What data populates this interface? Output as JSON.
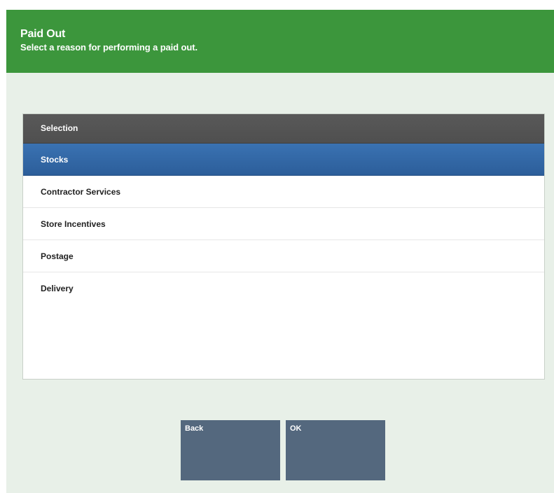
{
  "header": {
    "title": "Paid Out",
    "subtitle": "Select a reason for performing a paid out."
  },
  "list": {
    "column_header": "Selection",
    "selected_index": 0,
    "items": [
      "Stocks",
      "Contractor Services",
      "Store Incentives",
      "Postage",
      "Delivery"
    ]
  },
  "buttons": {
    "back_label": "Back",
    "ok_label": "OK"
  },
  "colors": {
    "header_bg": "#3c963c",
    "selected_row": "#2f64a2",
    "button_bg": "#54687e",
    "list_header_bg": "#555555"
  }
}
